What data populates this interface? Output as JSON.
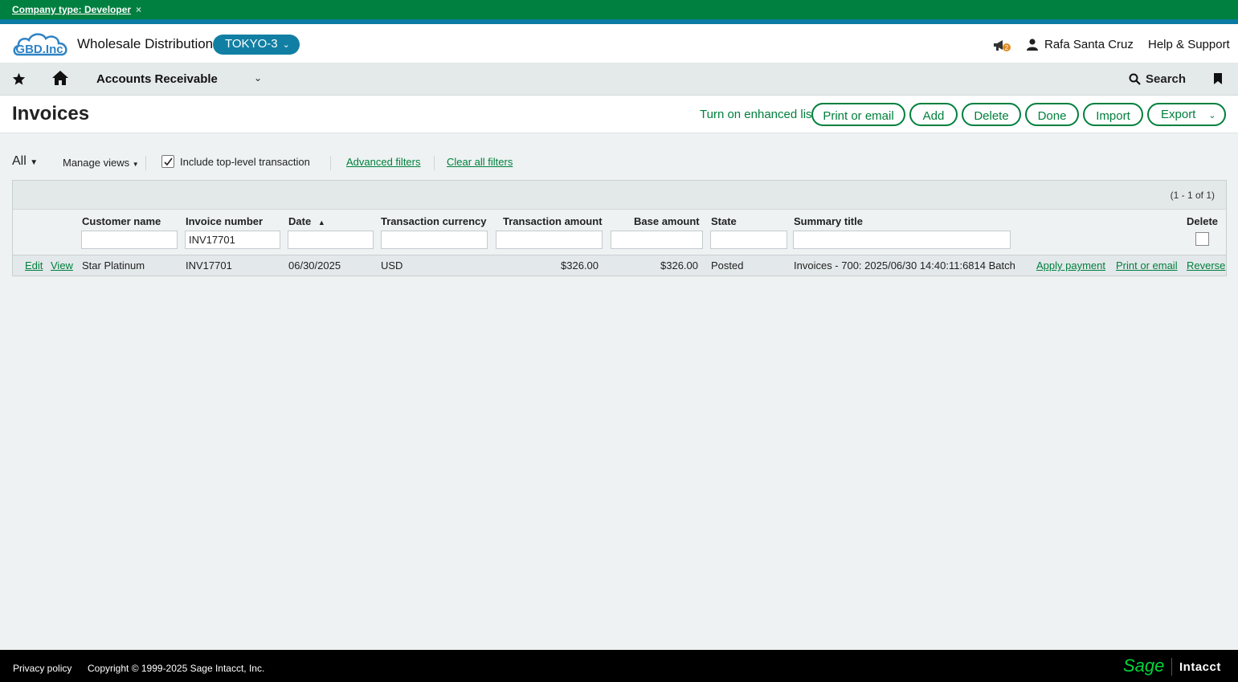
{
  "dev_banner": {
    "text": "Company type: Developer",
    "close_icon": "×"
  },
  "header": {
    "logo_text": "GBD.Inc",
    "company_name": "Wholesale Distribution",
    "entity": "TOKYO-3",
    "notification_count": "2",
    "user_name": "Rafa Santa Cruz",
    "help_label": "Help & Support"
  },
  "nav": {
    "module": "Accounts Receivable",
    "search_label": "Search"
  },
  "page": {
    "title": "Invoices",
    "enhanced_list": "Turn on enhanced list",
    "buttons": {
      "print": "Print or email",
      "add": "Add",
      "delete": "Delete",
      "done": "Done",
      "import": "Import",
      "export": "Export"
    }
  },
  "filters": {
    "view": "All",
    "manage_views": "Manage views",
    "include_label": "Include top-level transaction",
    "include_checked": true,
    "advanced": "Advanced filters",
    "clear": "Clear all filters"
  },
  "table": {
    "pagecount": "(1 - 1 of 1)",
    "columns": {
      "customer": "Customer name",
      "invoice": "Invoice number",
      "date": "Date",
      "currency": "Transaction currency",
      "amount": "Transaction amount",
      "base": "Base amount",
      "state": "State",
      "summary": "Summary title",
      "delete": "Delete"
    },
    "filter_values": {
      "invoice": "INV17701"
    },
    "rows": [
      {
        "edit": "Edit",
        "view": "View",
        "customer": "Star Platinum",
        "invoice": "INV17701",
        "date": "06/30/2025",
        "currency": "USD",
        "amount": "$326.00",
        "base": "$326.00",
        "state": "Posted",
        "summary": "Invoices - 700: 2025/06/30 14:40:11:6814 Batch",
        "apply": "Apply payment",
        "print": "Print or email",
        "reverse": "Reverse"
      }
    ]
  },
  "footer": {
    "privacy": "Privacy policy",
    "copyright": "Copyright © 1999-2025 Sage Intacct, Inc.",
    "brand_sage": "Sage",
    "brand_intacct": "Intacct"
  },
  "colors": {
    "green": "#00803d",
    "blue": "#117fa3",
    "banner": "#008040"
  }
}
